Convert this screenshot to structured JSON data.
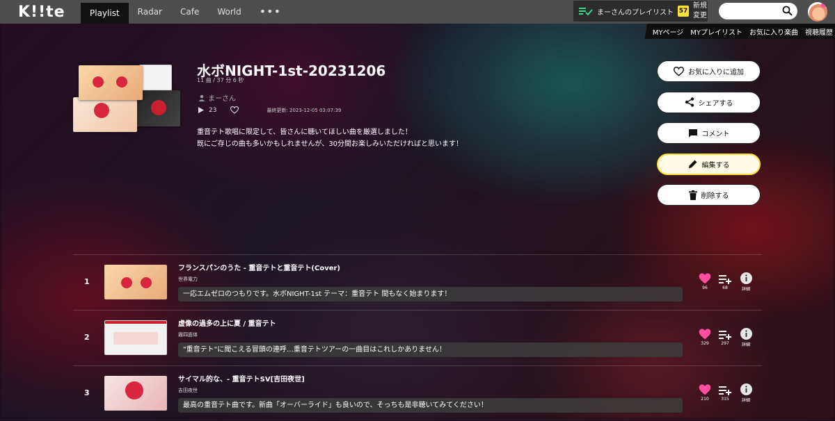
{
  "header": {
    "logo": "K!!te",
    "nav": [
      "Playlist",
      "Radar",
      "Cafe",
      "World"
    ],
    "nav_more": "•••",
    "playlist_box": {
      "label": "まーさんのプレイリスト",
      "count": "57",
      "side_top": "新規",
      "side_bottom": "変更"
    },
    "search": {
      "value": "",
      "placeholder": ""
    }
  },
  "subnav": [
    "MYページ",
    "MYプレイリスト",
    "お気に入り楽曲",
    "視聴履歴"
  ],
  "playlist": {
    "title": "水ボNIGHT-1st-20231206",
    "meta": "11 曲 / 37 分 6 秒",
    "owner": "まーさん",
    "plays": "23",
    "updated": "最終更新: 2023-12-05 03:07:39",
    "description_lines": [
      "重音テト歌唱に限定して、皆さんに聴いてほしい曲を厳選しました！",
      "既にご存じの曲も多いかもしれませんが、30分間お楽しみいただければと思います！"
    ]
  },
  "actions": {
    "favorite": "お気に入りに追加",
    "share": "シェアする",
    "comment": "コメント",
    "edit": "編集する",
    "delete": "削除する"
  },
  "tracks": [
    {
      "num": "1",
      "title": "フランスパンのうた - 重音テトと重音テト(Cover)",
      "artist": "世界電力",
      "comment": "一応エムゼロのつもりです。水ボNIGHT-1st テーマ：重音テト 間もなく始まります！",
      "likes": "96",
      "adds": "68",
      "info": "詳細"
    },
    {
      "num": "2",
      "title": "虚像の過多の上に夏 / 重音テト",
      "artist": "霧四面体",
      "comment": "\"重音テト\"に聞こえる冒頭の連呼…重音テトツアーの一曲目はこれしかありません！",
      "likes": "329",
      "adds": "297",
      "info": "詳細"
    },
    {
      "num": "3",
      "title": "サイマル的な、- 重音テトSV[吉田夜世]",
      "artist": "吉田夜世",
      "comment": "最高の重音テト曲です。新曲「オーバーライド」も良いので、そっちも是非聴いてみてください！",
      "likes": "210",
      "adds": "315",
      "info": "詳細"
    }
  ],
  "colors": {
    "header_bg": "#4e4e4e",
    "accent_yellow": "#ffe033",
    "heart_pink": "#ff4fa0"
  }
}
